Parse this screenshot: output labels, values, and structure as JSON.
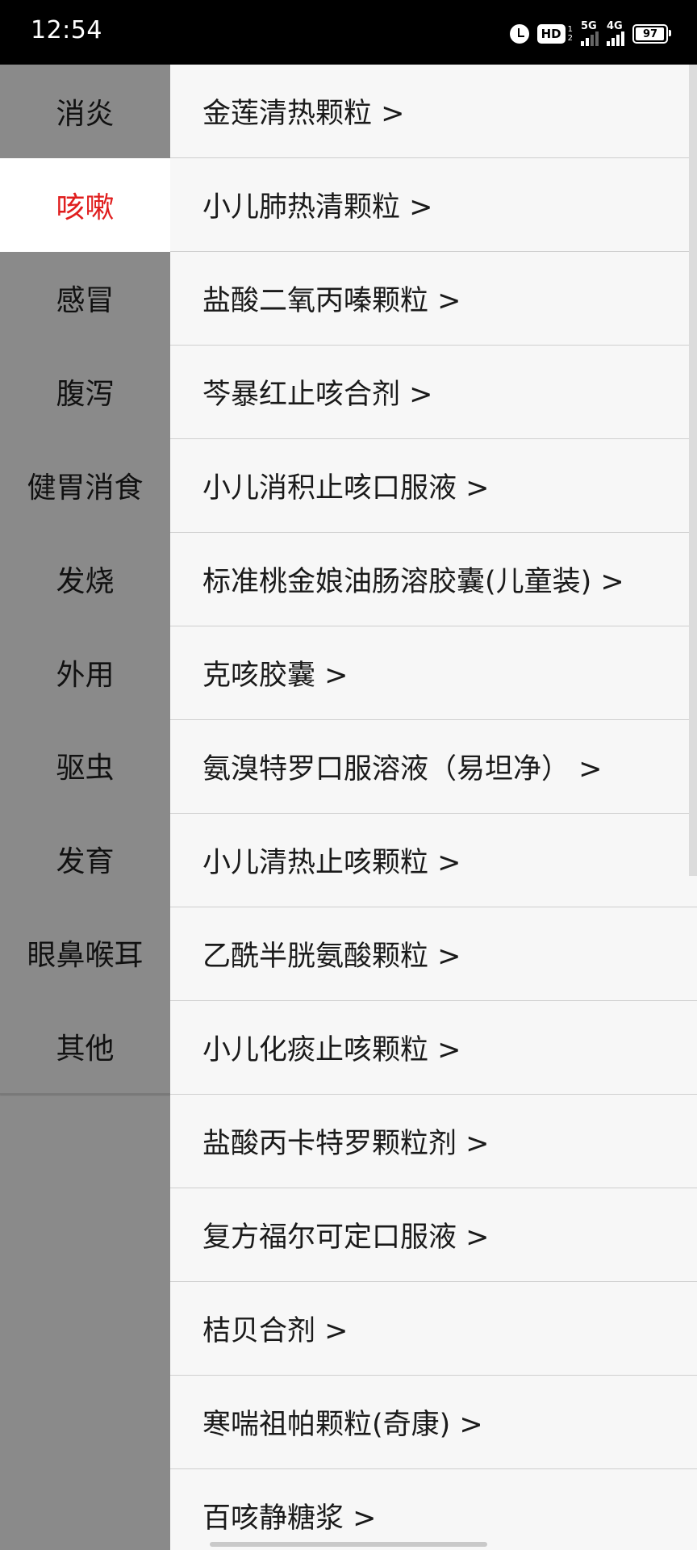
{
  "status_bar": {
    "time": "12:54",
    "hd_label": "HD",
    "sim_digits": [
      "1",
      "2"
    ],
    "network_1": "5G",
    "network_2": "4G",
    "battery": "97",
    "icons": [
      "alarm-icon",
      "hd-icon",
      "signal-5g-icon",
      "signal-4g-icon",
      "battery-icon"
    ]
  },
  "sidebar": {
    "selected_color": "#e01e1e",
    "items": [
      {
        "label": "消炎"
      },
      {
        "label": "咳嗽",
        "selected": true
      },
      {
        "label": "感冒"
      },
      {
        "label": "腹泻"
      },
      {
        "label": "健胃消食"
      },
      {
        "label": "发烧"
      },
      {
        "label": "外用"
      },
      {
        "label": "驱虫"
      },
      {
        "label": "发育"
      },
      {
        "label": "眼鼻喉耳"
      },
      {
        "label": "其他"
      }
    ]
  },
  "list": {
    "items": [
      {
        "label": "金莲清热颗粒 >"
      },
      {
        "label": "小儿肺热清颗粒 >"
      },
      {
        "label": "盐酸二氧丙嗪颗粒 >"
      },
      {
        "label": "芩暴红止咳合剂 >"
      },
      {
        "label": "小儿消积止咳口服液 >"
      },
      {
        "label": "标准桃金娘油肠溶胶囊(儿童装) >"
      },
      {
        "label": "克咳胶囊 >"
      },
      {
        "label": "氨溴特罗口服溶液（易坦净） >"
      },
      {
        "label": "小儿清热止咳颗粒 >"
      },
      {
        "label": "乙酰半胱氨酸颗粒 >"
      },
      {
        "label": "小儿化痰止咳颗粒 >"
      },
      {
        "label": "盐酸丙卡特罗颗粒剂 >"
      },
      {
        "label": "复方福尔可定口服液 >"
      },
      {
        "label": "桔贝合剂 >"
      },
      {
        "label": "寒喘祖帕颗粒(奇康) >"
      },
      {
        "label": "百咳静糖浆 >"
      }
    ]
  }
}
